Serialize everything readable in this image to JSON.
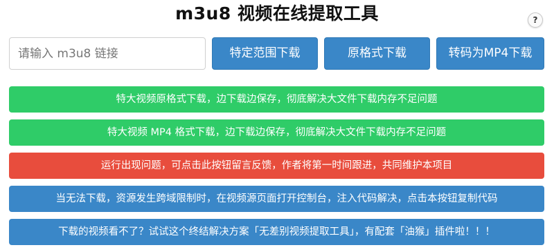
{
  "header": {
    "title": "m3u8 视频在线提取工具",
    "help_label": "?"
  },
  "input": {
    "placeholder": "请输入 m3u8 链接",
    "value": ""
  },
  "buttons": {
    "range_download": "特定范围下载",
    "original_download": "原格式下载",
    "mp4_download": "转码为MP4下载"
  },
  "bars": [
    {
      "label": "特大视频原格式下载，边下载边保存，彻底解决大文件下载内存不足问题",
      "color": "#2fcc68"
    },
    {
      "label": "特大视频 MP4 格式下载，边下载边保存，彻底解决大文件下载内存不足问题",
      "color": "#2fcc68"
    },
    {
      "label": "运行出现问题，可点击此按钮留言反馈，作者将第一时间跟进，共同维护本项目",
      "color": "#e84d3d"
    },
    {
      "label": "当无法下载，资源发生跨域限制时，在视频源页面打开控制台，注入代码解决，点击本按钮复制代码",
      "color": "#3a87c8"
    },
    {
      "label": "下载的视频看不了？试试这个终结解决方案「无差别视频提取工具」，有配套「油猴」插件啦！！！",
      "color": "#3a87c8"
    }
  ],
  "colors": {
    "primary": "#3a87c8",
    "success": "#2fcc68",
    "danger": "#e84d3d"
  }
}
